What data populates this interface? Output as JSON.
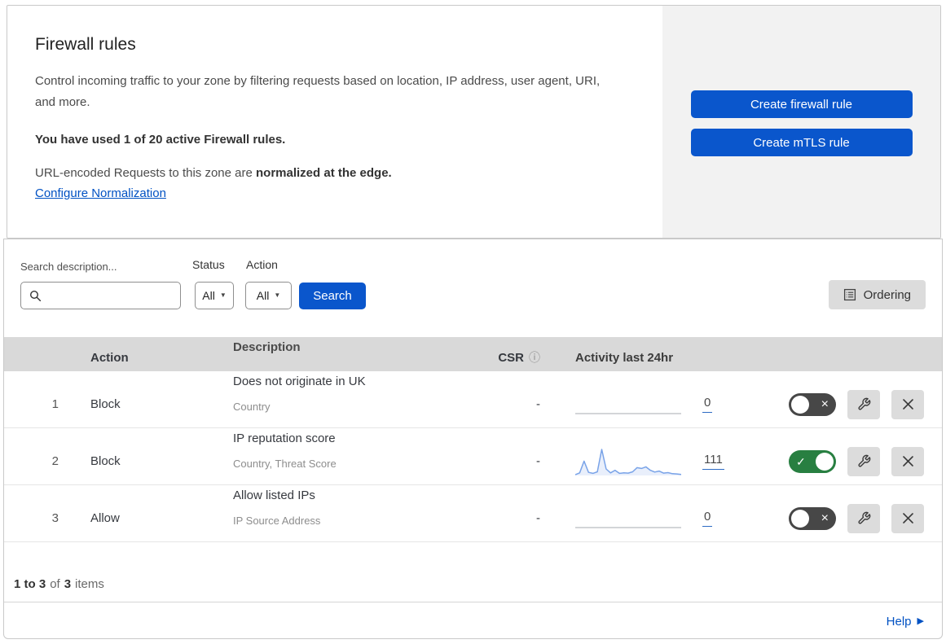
{
  "icons": {
    "chevron_down": "▼",
    "info": "ⓘ",
    "check": "✓",
    "cross": "×",
    "help_arrow": "▶"
  },
  "colors": {
    "accent_blue": "#0a56cc",
    "link_blue": "#0051c3",
    "toggle_on_green": "#287f41",
    "toggle_off_gray": "#474747",
    "spark_stroke": "#79a3e8",
    "spark_fill": "#e9effb",
    "flat_line": "#b9bcc1",
    "panel_gray": "#f2f2f2",
    "table_header_gray": "#d9d9d9"
  },
  "header": {
    "title": "Firewall rules",
    "description": "Control incoming traffic to your zone by filtering requests based on location, IP address, user agent, URI, and more.",
    "usage": "You have used 1 of 20 active Firewall rules.",
    "normalization_text": "URL-encoded Requests to this zone are ",
    "normalization_bold": "normalized at the edge.",
    "normalization_link": "Configure Normalization"
  },
  "actions_panel": {
    "create_firewall_rule": "Create firewall rule",
    "create_mtls_rule": "Create mTLS rule"
  },
  "filters": {
    "search_label": "Search description...",
    "search_placeholder": "",
    "status_label": "Status",
    "status_value": "All",
    "action_label": "Action",
    "action_value": "All",
    "search_button": "Search",
    "ordering_button": "Ordering"
  },
  "table": {
    "columns": {
      "action": "Action",
      "description": "Description",
      "csr": "CSR",
      "activity": "Activity last 24hr"
    },
    "rows": [
      {
        "index": "1",
        "action": "Block",
        "description": "Does not originate in UK",
        "criteria": "Country",
        "csr": "-",
        "activity_count": "0",
        "enabled": false,
        "sparkline": []
      },
      {
        "index": "2",
        "action": "Block",
        "description": "IP reputation score",
        "criteria": "Country, Threat Score",
        "csr": "-",
        "activity_count": "111",
        "enabled": true,
        "sparkline": [
          3,
          10,
          55,
          12,
          8,
          14,
          100,
          25,
          10,
          20,
          8,
          10,
          9,
          14,
          30,
          27,
          33,
          20,
          13,
          17,
          9,
          11,
          7,
          6,
          4
        ]
      },
      {
        "index": "3",
        "action": "Allow",
        "description": "Allow listed IPs",
        "criteria": "IP Source Address",
        "csr": "-",
        "activity_count": "0",
        "enabled": false,
        "sparkline": []
      }
    ]
  },
  "footer": {
    "range": "1 to 3",
    "of": "of",
    "total": "3",
    "items": "items",
    "help": "Help"
  }
}
